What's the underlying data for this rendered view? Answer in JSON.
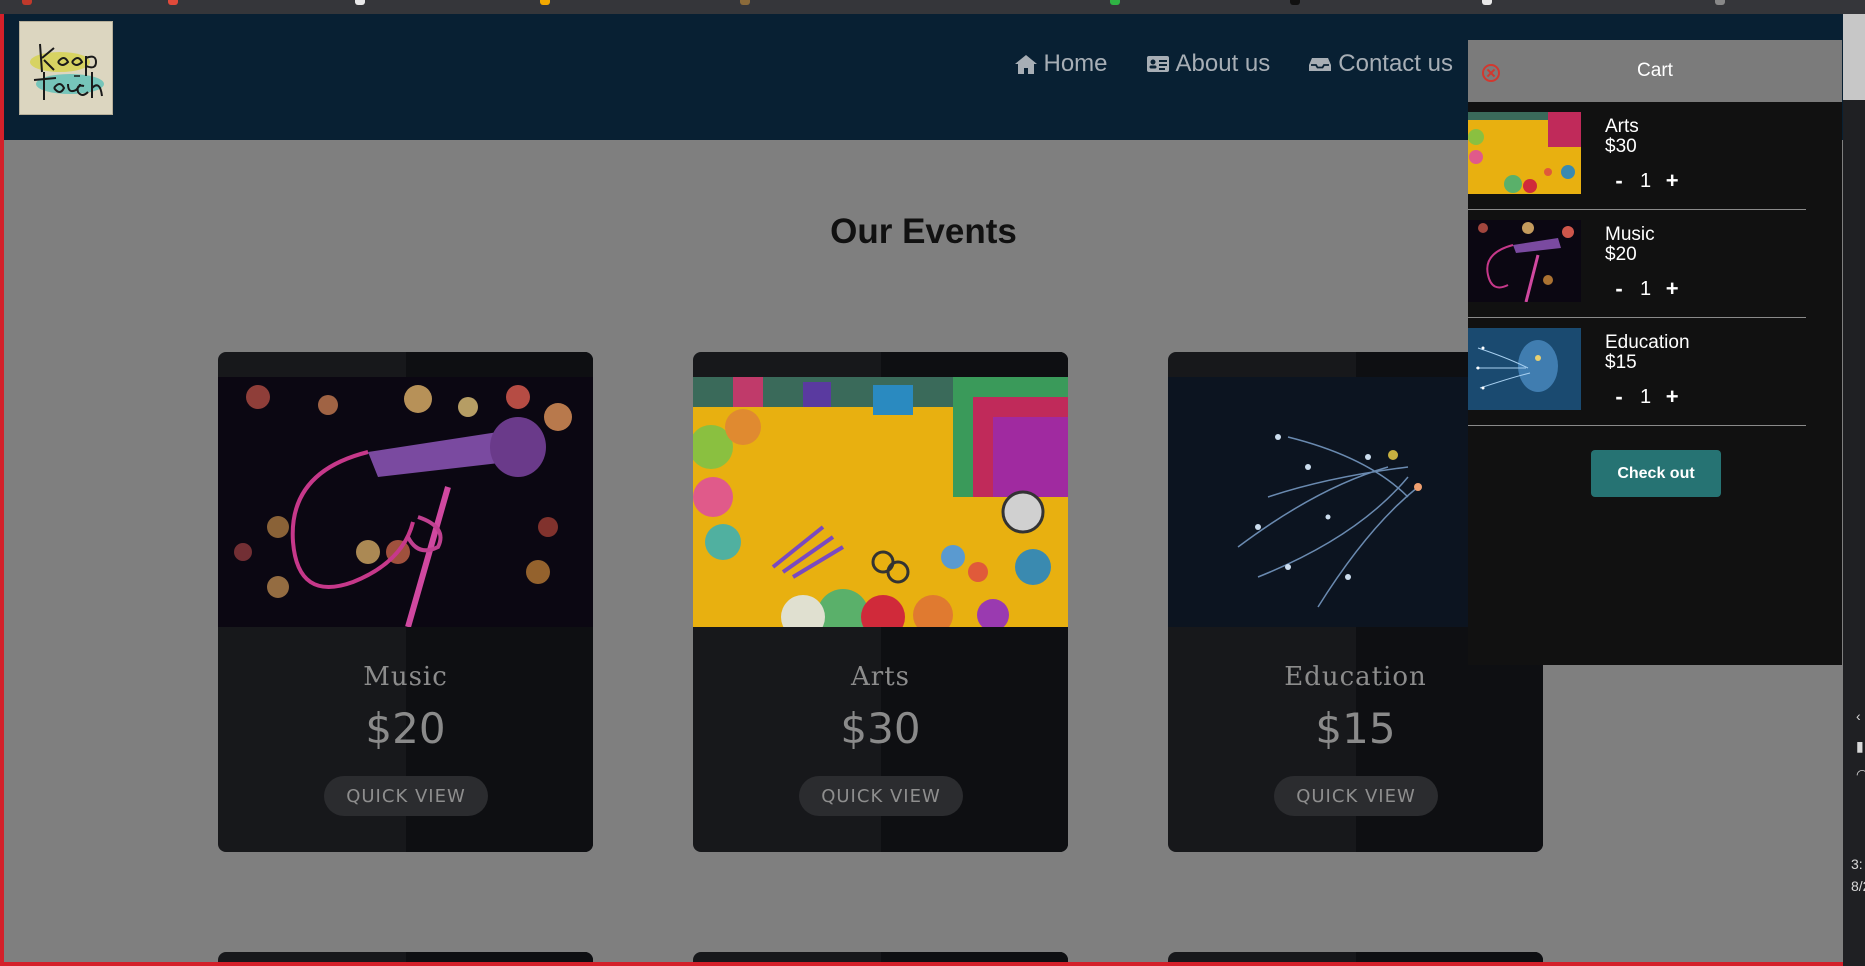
{
  "header": {
    "nav": [
      {
        "label": "Home",
        "icon": "home-icon"
      },
      {
        "label": "About us",
        "icon": "id-card-icon"
      },
      {
        "label": "Contact us",
        "icon": "inbox-icon"
      }
    ]
  },
  "main": {
    "title": "Our Events",
    "events": [
      {
        "name": "Music",
        "price": "$20",
        "button": "QUICK VIEW"
      },
      {
        "name": "Arts",
        "price": "$30",
        "button": "QUICK VIEW"
      },
      {
        "name": "Education",
        "price": "$15",
        "button": "QUICK VIEW"
      }
    ]
  },
  "cart": {
    "title": "Cart",
    "items": [
      {
        "name": "Arts",
        "price": "$30",
        "qty": "1",
        "minus": "-",
        "plus": "+"
      },
      {
        "name": "Music",
        "price": "$20",
        "qty": "1",
        "minus": "-",
        "plus": "+"
      },
      {
        "name": "Education",
        "price": "$15",
        "qty": "1",
        "minus": "-",
        "plus": "+"
      }
    ],
    "checkout_label": "Check out"
  },
  "tray": {
    "time": "3:",
    "date": "8/2"
  },
  "colors": {
    "header_bg": "#082033",
    "cart_header": "#7b7b7b",
    "checkout": "#267373",
    "close": "#d2382f"
  }
}
